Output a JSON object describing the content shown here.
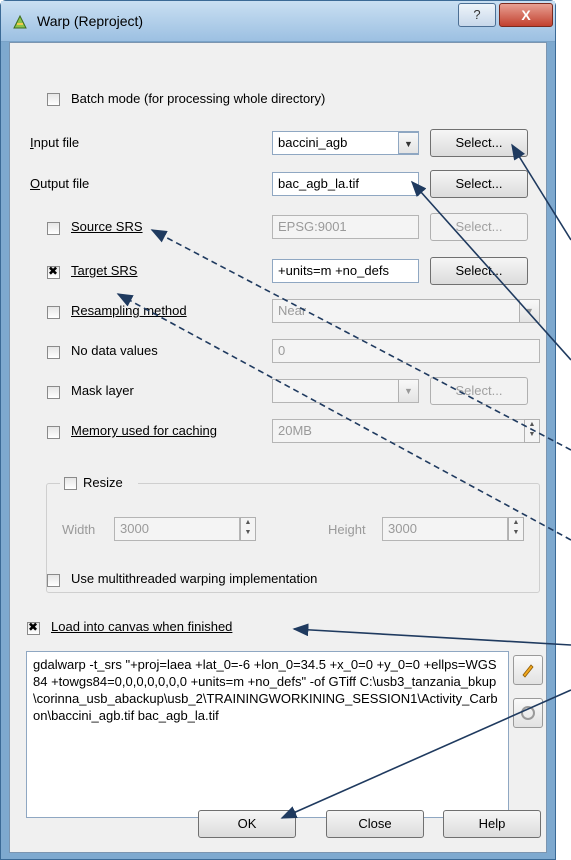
{
  "window": {
    "title": "Warp (Reproject)",
    "help_label": "?",
    "close_label": "X"
  },
  "batch": {
    "label": "Batch mode (for processing whole directory)",
    "checked": false
  },
  "input": {
    "label": "Input file",
    "value": "baccini_agb",
    "button": "Select..."
  },
  "output": {
    "label": "Output file",
    "value": "bac_agb_la.tif",
    "button": "Select..."
  },
  "source_srs": {
    "label": "Source SRS",
    "value": "EPSG:9001",
    "button": "Select...",
    "checked": false
  },
  "target_srs": {
    "label": "Target SRS",
    "value": "+units=m +no_defs",
    "button": "Select...",
    "checked": true
  },
  "resampling": {
    "label": "Resampling method",
    "value": "Near",
    "checked": false
  },
  "nodata": {
    "label": "No data values",
    "value": "0",
    "checked": false
  },
  "mask": {
    "label": "Mask layer",
    "value": "",
    "button": "Select...",
    "checked": false
  },
  "memory": {
    "label": "Memory used for caching",
    "value": "20MB",
    "checked": false
  },
  "resize": {
    "label": "Resize",
    "width_label": "Width",
    "width_value": "3000",
    "height_label": "Height",
    "height_value": "3000",
    "checked": false
  },
  "multithread": {
    "label": "Use multithreaded warping implementation",
    "checked": false
  },
  "load_canvas": {
    "label": "Load into canvas when finished",
    "checked": true
  },
  "command": "gdalwarp -t_srs \"+proj=laea +lat_0=-6 +lon_0=34.5 +x_0=0 +y_0=0 +ellps=WGS84 +towgs84=0,0,0,0,0,0,0 +units=m +no_defs\" -of GTiff C:\\usb3_tanzania_bkup\\corinna_usb_abackup\\usb_2\\TRAININGWORKINING_SESSION1\\Activity_Carbon\\baccini_agb.tif bac_agb_la.tif",
  "footer": {
    "ok": "OK",
    "close": "Close",
    "help": "Help"
  },
  "icons": {
    "edit": "pencil-icon",
    "reset": "reset-icon"
  }
}
